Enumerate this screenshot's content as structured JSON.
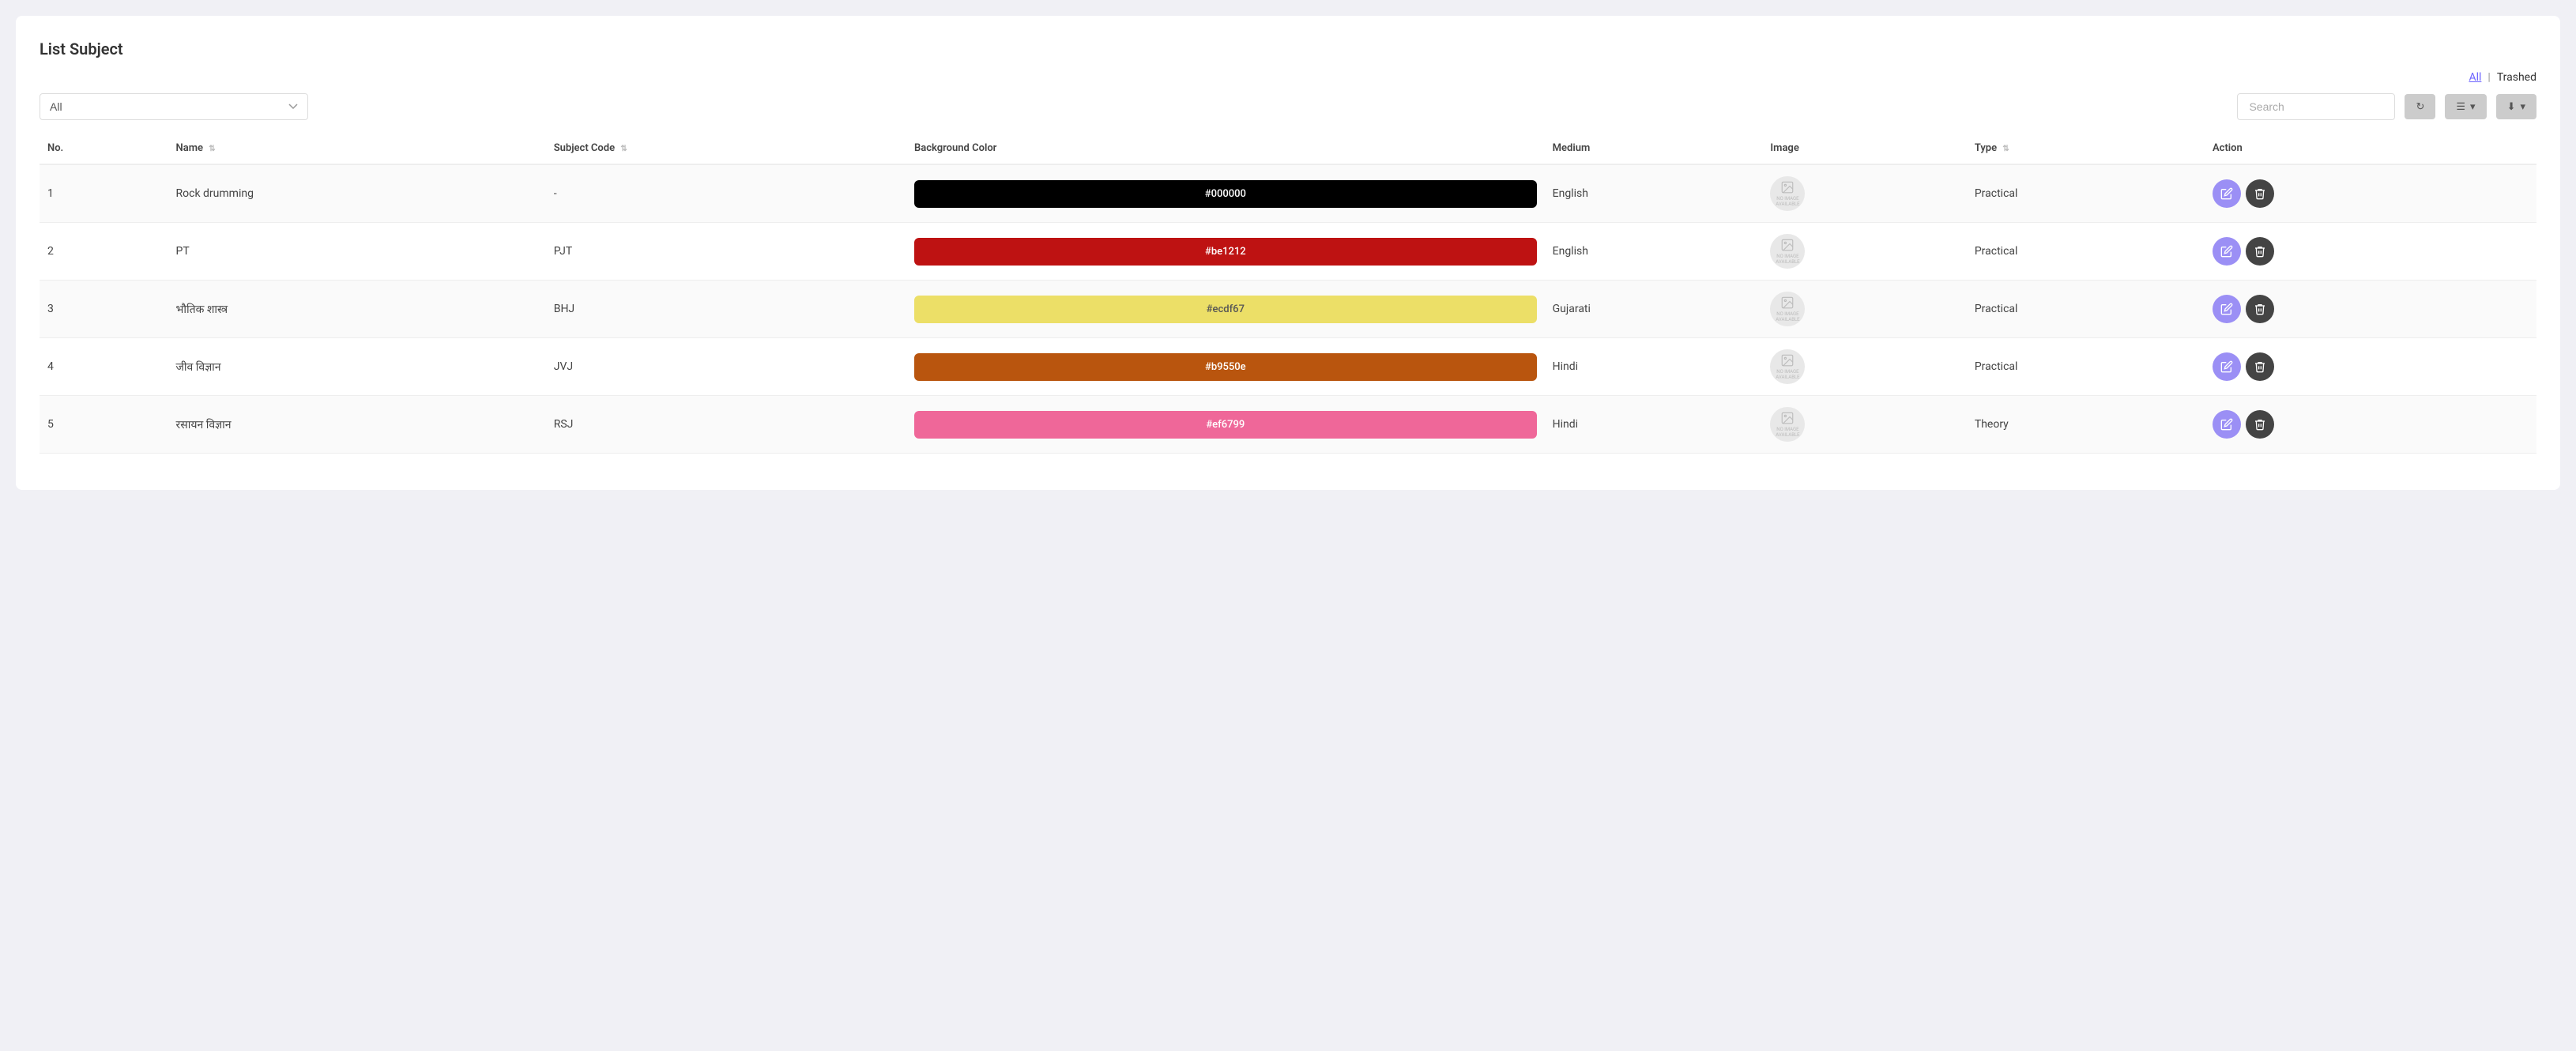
{
  "page": {
    "title": "List Subject",
    "links": {
      "all": "All",
      "separator": "|",
      "trashed": "Trashed"
    }
  },
  "toolbar": {
    "filter_default": "All",
    "search_placeholder": "Search",
    "refresh_label": "",
    "view_label": "",
    "export_label": ""
  },
  "table": {
    "columns": [
      {
        "key": "no",
        "label": "No."
      },
      {
        "key": "name",
        "label": "Name"
      },
      {
        "key": "subject_code",
        "label": "Subject Code"
      },
      {
        "key": "background_color",
        "label": "Background Color"
      },
      {
        "key": "medium",
        "label": "Medium"
      },
      {
        "key": "image",
        "label": "Image"
      },
      {
        "key": "type",
        "label": "Type"
      },
      {
        "key": "action",
        "label": "Action"
      }
    ],
    "rows": [
      {
        "no": "1",
        "name": "Rock drumming",
        "subject_code": "-",
        "bg_color": "#000000",
        "bg_color_text": "#000000",
        "text_light": false,
        "medium": "English",
        "image_alt": "No Image Available",
        "type": "Practical"
      },
      {
        "no": "2",
        "name": "PT",
        "subject_code": "PJT",
        "bg_color": "#be1212",
        "bg_color_text": "#be1212",
        "text_light": false,
        "medium": "English",
        "image_alt": "No Image Available",
        "type": "Practical"
      },
      {
        "no": "3",
        "name": "भौतिक शास्त्र",
        "subject_code": "BHJ",
        "bg_color": "#ecdf67",
        "bg_color_text": "#ecdf67",
        "text_light": true,
        "medium": "Gujarati",
        "image_alt": "No Image Available",
        "type": "Practical"
      },
      {
        "no": "4",
        "name": "जीव विज्ञान",
        "subject_code": "JVJ",
        "bg_color": "#b9550e",
        "bg_color_text": "#b9550e",
        "text_light": false,
        "medium": "Hindi",
        "image_alt": "No Image Available",
        "type": "Practical"
      },
      {
        "no": "5",
        "name": "रसायन विज्ञान",
        "subject_code": "RSJ",
        "bg_color": "#ef6799",
        "bg_color_text": "#ef6799",
        "text_light": false,
        "medium": "Hindi",
        "image_alt": "No Image Available",
        "type": "Theory"
      }
    ]
  },
  "icons": {
    "sort": "⇅",
    "refresh": "↻",
    "list": "☰",
    "download": "⬇",
    "edit": "✏",
    "delete": "🗑",
    "chevron_down": "▾"
  }
}
